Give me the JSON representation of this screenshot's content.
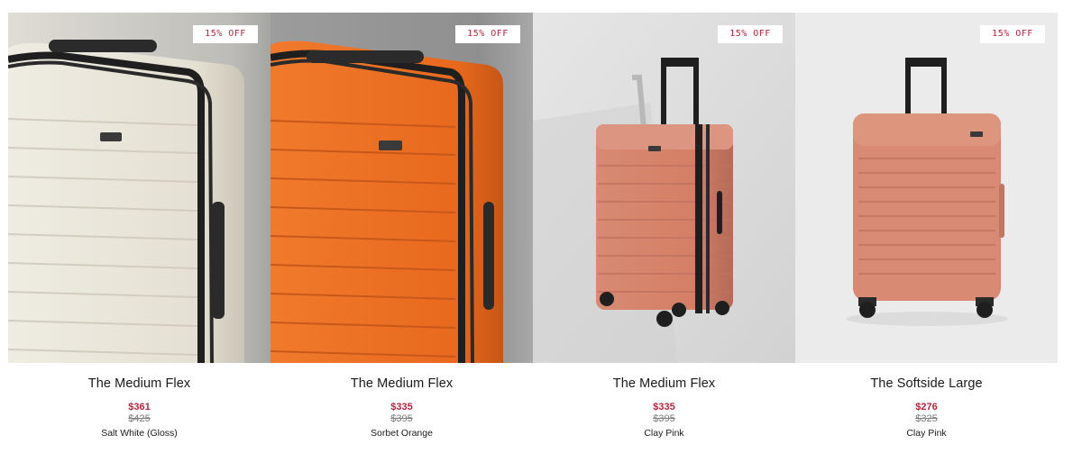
{
  "products": [
    {
      "badge": "15% OFF",
      "name": "The Medium Flex",
      "sale_price": "$361",
      "original_price": "$425",
      "color_name": "Salt White (Gloss)",
      "colors": {
        "bg": "#c8c8c6",
        "body": "#e6e2d6",
        "shade": "#cfcabc",
        "zip": "#1f1f1f"
      }
    },
    {
      "badge": "15% OFF",
      "name": "The Medium Flex",
      "sale_price": "$335",
      "original_price": "$395",
      "color_name": "Sorbet Orange",
      "colors": {
        "bg": "#9a9a9a",
        "body": "#ec6e22",
        "shade": "#c95818",
        "zip": "#1f1f1f"
      }
    },
    {
      "badge": "15% OFF",
      "name": "The Medium Flex",
      "sale_price": "$335",
      "original_price": "$395",
      "color_name": "Clay Pink",
      "colors": {
        "bg": "#dcdcdc",
        "body": "#d8846c",
        "shade": "#b86c58",
        "zip": "#1f1f1f"
      }
    },
    {
      "badge": "15% OFF",
      "name": "The Softside Large",
      "sale_price": "$276",
      "original_price": "$325",
      "color_name": "Clay Pink",
      "colors": {
        "bg": "#ececec",
        "body": "#d98970",
        "shade": "#c27560",
        "zip": "#1f1f1f"
      }
    }
  ],
  "ui": {
    "accent": "#b3263e",
    "text": "#1a1a1a",
    "muted": "#7a7a7a"
  }
}
